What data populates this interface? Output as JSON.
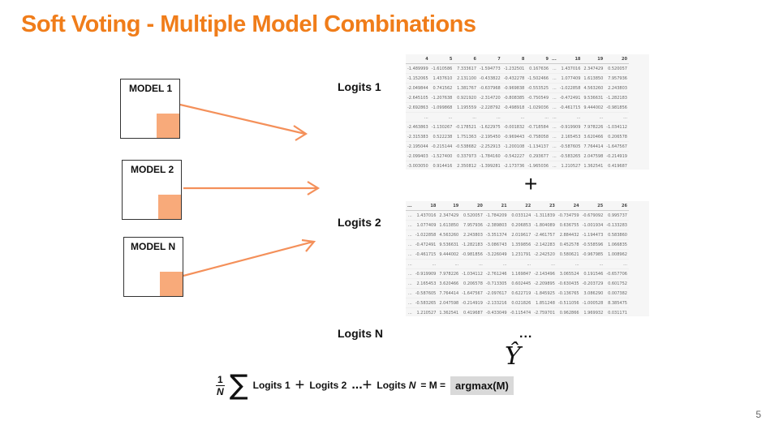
{
  "title": "Soft Voting - Multiple Model Combinations",
  "models": [
    {
      "label": "MODEL 1"
    },
    {
      "label": "MODEL 2"
    },
    {
      "label": "MODEL N"
    }
  ],
  "logits_labels": [
    "Logits 1",
    "Logits 2",
    "Logits N"
  ],
  "table1": {
    "headers": [
      "4",
      "5",
      "6",
      "7",
      "8",
      "9",
      "...",
      "18",
      "19",
      "20"
    ],
    "rows": [
      [
        "-1.489999",
        "-1.610586",
        "7.333617",
        "-1.594773",
        "-1.232501",
        "0.167636",
        "...",
        "1.437016",
        "2.347429",
        "0.520057"
      ],
      [
        "-1.152065",
        "1.437610",
        "2.131100",
        "-0.433822",
        "-0.432278",
        "-1.502466",
        "...",
        "1.077409",
        "1.613850",
        "7.957936"
      ],
      [
        "-2.049844",
        "0.741562",
        "1.381767",
        "-0.637968",
        "-0.969838",
        "-0.553525",
        "...",
        "-1.022858",
        "4.563260",
        "2.243803"
      ],
      [
        "-2.645105",
        "-1.207638",
        "0.921920",
        "-2.314720",
        "-0.808385",
        "-0.750549",
        "...",
        "-0.472491",
        "9.536631",
        "-1.282183"
      ],
      [
        "-2.692863",
        "-1.099868",
        "1.195559",
        "-2.228792",
        "-0.498918",
        "-1.029036",
        "...",
        "-0.461715",
        "9.444002",
        "-0.981856"
      ],
      [
        "...",
        "...",
        "...",
        "...",
        "...",
        "...",
        "...",
        "...",
        "...",
        "..."
      ],
      [
        "-2.463863",
        "-1.130267",
        "-0.178521",
        "-1.622975",
        "-0.001832",
        "-0.718584",
        "...",
        "-0.919909",
        "7.978226",
        "-1.034112"
      ],
      [
        "-2.315383",
        "0.522238",
        "1.751363",
        "-2.195450",
        "-0.969443",
        "-0.758058",
        "...",
        "2.165453",
        "3.620466",
        "0.206578"
      ],
      [
        "-2.195044",
        "-0.215144",
        "-0.538682",
        "-2.252913",
        "-1.200108",
        "-1.134137",
        "...",
        "-0.587605",
        "7.764414",
        "-1.647567"
      ],
      [
        "-2.099403",
        "-1.527400",
        "0.337973",
        "-1.784160",
        "-0.542227",
        "0.293677",
        "...",
        "-0.583265",
        "2.047598",
        "-0.214919"
      ],
      [
        "-3.003050",
        "0.914416",
        "2.350812",
        "-1.399281",
        "-2.173736",
        "-1.965036",
        "...",
        "1.210527",
        "1.362541",
        "0.419687"
      ]
    ]
  },
  "table2": {
    "headers": [
      "...",
      "18",
      "19",
      "20",
      "21",
      "22",
      "23",
      "24",
      "25",
      "26"
    ],
    "rows": [
      [
        "...",
        "1.437016",
        "2.347429",
        "0.520057",
        "-1.784209",
        "0.033124",
        "-1.311839",
        "-0.734759",
        "-0.679092",
        "0.995737"
      ],
      [
        "...",
        "1.077409",
        "1.613850",
        "7.957936",
        "-2.389803",
        "0.206853",
        "-1.804089",
        "0.636755",
        "-1.001934",
        "-0.133283"
      ],
      [
        "...",
        "-1.022858",
        "4.563260",
        "2.243803",
        "-3.351374",
        "2.019617",
        "-2.461757",
        "2.884432",
        "-1.194473",
        "0.583860"
      ],
      [
        "...",
        "-0.472491",
        "9.536631",
        "-1.282183",
        "-3.086743",
        "1.359856",
        "-2.142283",
        "0.452578",
        "-0.558596",
        "1.066835"
      ],
      [
        "...",
        "-0.461715",
        "9.444002",
        "-0.981856",
        "-3.226049",
        "1.231791",
        "-2.242520",
        "0.580621",
        "-0.967985",
        "1.008962"
      ],
      [
        "...",
        "...",
        "...",
        "...",
        "...",
        "...",
        "...",
        "...",
        "...",
        "..."
      ],
      [
        "...",
        "-0.919909",
        "7.978226",
        "-1.034112",
        "-2.761246",
        "1.169847",
        "-2.143496",
        "3.065524",
        "0.191546",
        "-0.657706"
      ],
      [
        "...",
        "2.165453",
        "3.620466",
        "0.206578",
        "-0.713305",
        "0.602445",
        "-2.209895",
        "-0.630435",
        "-0.203729",
        "0.601752"
      ],
      [
        "...",
        "-0.587605",
        "7.764414",
        "-1.647567",
        "-2.097617",
        "0.622719",
        "-1.845925",
        "-0.136765",
        "3.086290",
        "0.007382"
      ],
      [
        "...",
        "-0.583265",
        "2.047598",
        "-0.214919",
        "-2.133216",
        "0.021826",
        "1.851248",
        "-0.511056",
        "-1.000528",
        "8.385475"
      ],
      [
        "...",
        "1.210527",
        "1.362541",
        "0.419687",
        "-0.433049",
        "-0.115474",
        "-2.759701",
        "0.962866",
        "1.969932",
        "0.031171"
      ]
    ]
  },
  "plus_sign": "+",
  "ellipsis": "...",
  "yhat": "Ŷ",
  "formula": {
    "frac_num": "1",
    "frac_den": "N",
    "sigma": "∑",
    "term1": "Logits 1",
    "plus1": "+",
    "term2": "Logits 2",
    "dots": "...",
    "plus2": "+",
    "term3_prefix": "Logits ",
    "term3_var": "N",
    "equals1": "= M =",
    "argmax": "argmax(M)"
  },
  "page_number": "5",
  "colors": {
    "title": "#f07d1a",
    "arrow": "#f4905a",
    "model_fill": "#f8aa7a"
  }
}
